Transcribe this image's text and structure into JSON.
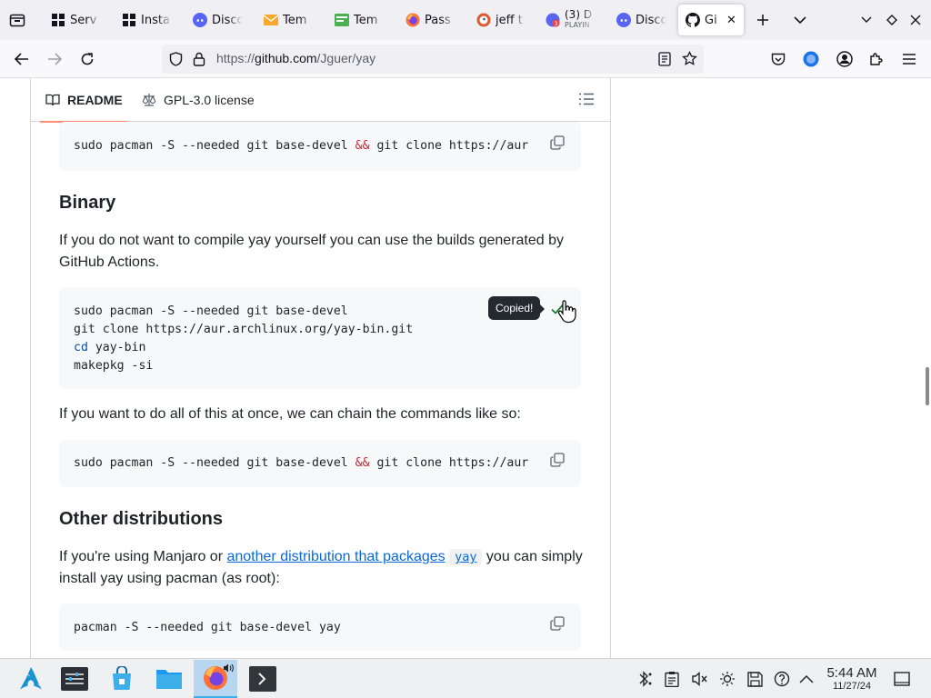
{
  "browser": {
    "tabs": [
      {
        "title": "Serv",
        "icon": "terminal-icon"
      },
      {
        "title": "Insta",
        "icon": "terminal-icon"
      },
      {
        "title": "Disco",
        "icon": "discord-icon"
      },
      {
        "title": "Tem",
        "icon": "mail-icon"
      },
      {
        "title": "Tem",
        "icon": "inbox-icon"
      },
      {
        "title": "Pass",
        "icon": "firefox-icon"
      },
      {
        "title": "jeff t",
        "icon": "duckduckgo-icon"
      },
      {
        "title": "(3) D",
        "subtitle": "PLAYIN",
        "icon": "discord-red-icon"
      },
      {
        "title": "Disco",
        "icon": "discord-icon"
      },
      {
        "title": "Gi",
        "icon": "github-icon",
        "active": true
      }
    ],
    "url_prefix": "https://",
    "url_host": "github.com",
    "url_path": "/Jguer/yay"
  },
  "readme": {
    "tab_readme": "README",
    "tab_license": "GPL-3.0 license",
    "code1": {
      "a": "sudo pacman -S --needed git base-devel ",
      "op": "&&",
      "b": " git clone https://aur"
    },
    "heading_binary": "Binary",
    "para_binary": "If you do not want to compile yay yourself you can use the builds generated by GitHub Actions.",
    "code2": {
      "line1": "sudo pacman -S --needed git base-devel",
      "line2": "git clone https://aur.archlinux.org/yay-bin.git",
      "line3_kw": "cd",
      "line3_rest": " yay-bin",
      "line4": "makepkg -si"
    },
    "tooltip": "Copied!",
    "para_chain": "If you want to do all of this at once, we can chain the commands like so:",
    "code3": {
      "a": "sudo pacman -S --needed git base-devel ",
      "op": "&&",
      "b": " git clone https://aur"
    },
    "heading_other": "Other distributions",
    "para_other_a": "If you're using Manjaro or ",
    "para_other_link": "another distribution that packages",
    "para_other_code": "yay",
    "para_other_b": " you can simply install yay using pacman (as root):",
    "code4": "pacman -S --needed git base-devel yay"
  },
  "taskbar": {
    "time": "5:44 AM",
    "date": "11/27/24"
  },
  "colors": {
    "link": "#0969da",
    "code_bg": "#f6f8fa",
    "tab_underline": "#fd8c73",
    "taskbar_active": "#b8d6ef"
  }
}
